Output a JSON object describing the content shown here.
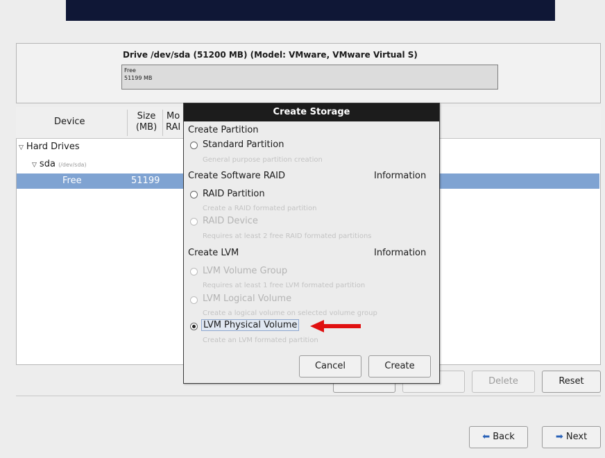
{
  "drive": {
    "title": "Drive /dev/sda (51200 MB) (Model: VMware, VMware Virtual S)",
    "free_label": "Free",
    "free_size": "51199 MB"
  },
  "table": {
    "columns": [
      "Device",
      "Size\n(MB)",
      "Mo\nRAI"
    ],
    "col_device": "Device",
    "col_size_1": "Size",
    "col_size_2": "(MB)",
    "col_mount_1": "Mo",
    "col_mount_2": "RAI",
    "rows": {
      "hard_drives": "Hard Drives",
      "sda": "sda",
      "sda_path": "(/dev/sda)",
      "free": "Free",
      "free_size": "51199"
    }
  },
  "buttons": {
    "delete": "Delete",
    "reset": "Reset",
    "back": "Back",
    "next": "Next"
  },
  "dialog": {
    "title": "Create Storage",
    "sec_partition": "Create Partition",
    "std_partition": "Standard Partition",
    "std_partition_desc": "General purpose partition creation",
    "sec_raid": "Create Software RAID",
    "info": "Information",
    "raid_partition": "RAID Partition",
    "raid_partition_desc": "Create a RAID formated partition",
    "raid_device": "RAID Device",
    "raid_device_desc": "Requires at least 2 free RAID formated partitions",
    "sec_lvm": "Create LVM",
    "lvm_vg": "LVM Volume Group",
    "lvm_vg_desc": "Requires at least 1 free LVM formated partition",
    "lvm_lv": "LVM Logical Volume",
    "lvm_lv_desc": "Create a logical volume on selected volume group",
    "lvm_pv": "LVM Physical Volume",
    "lvm_pv_desc": "Create an LVM formated partition",
    "cancel": "Cancel",
    "create": "Create"
  },
  "colors": {
    "banner": "#0f1736",
    "selected_row": "#7fa3d2",
    "annotation_arrow": "#e01010"
  }
}
